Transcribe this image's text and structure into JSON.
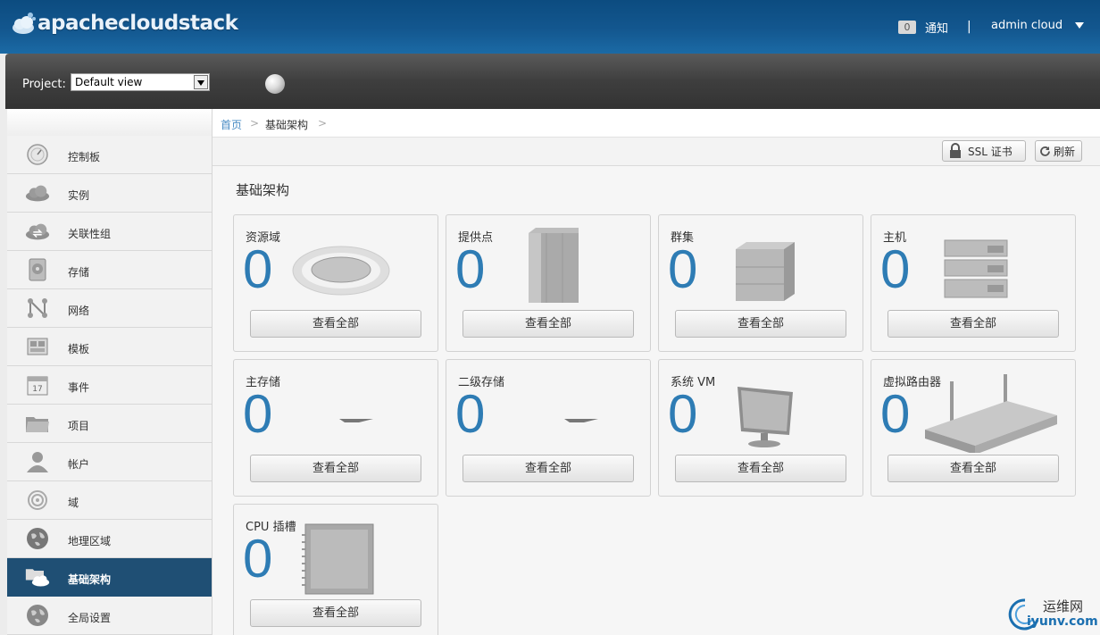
{
  "header": {
    "brand": "apachecloudstack",
    "notification_count": "0",
    "notification_label": "通知",
    "separator": "|",
    "user_label": "admin cloud"
  },
  "projbar": {
    "label": "Project:",
    "selected": "Default view"
  },
  "sidebar": {
    "items": [
      {
        "label": "控制板",
        "icon": "dashboard-icon"
      },
      {
        "label": "实例",
        "icon": "cloud-icon"
      },
      {
        "label": "关联性组",
        "icon": "affinity-icon"
      },
      {
        "label": "存储",
        "icon": "storage-icon"
      },
      {
        "label": "网络",
        "icon": "network-icon"
      },
      {
        "label": "模板",
        "icon": "template-icon"
      },
      {
        "label": "事件",
        "icon": "calendar-icon"
      },
      {
        "label": "项目",
        "icon": "folder-icon"
      },
      {
        "label": "帐户",
        "icon": "user-icon"
      },
      {
        "label": "域",
        "icon": "domain-icon"
      },
      {
        "label": "地理区域",
        "icon": "globe-icon"
      },
      {
        "label": "基础架构",
        "icon": "infrastructure-icon",
        "active": true
      },
      {
        "label": "全局设置",
        "icon": "settings-globe-icon"
      }
    ],
    "calendar_day": "17"
  },
  "breadcrumb": {
    "home": "首页",
    "sep1": ">",
    "current": "基础架构",
    "sep2": ">"
  },
  "toolbar": {
    "ssl_label": "SSL 证书",
    "refresh_label": "刷新"
  },
  "main": {
    "title": "基础架构",
    "cards": [
      {
        "title": "资源域",
        "count": "0",
        "button": "查看全部"
      },
      {
        "title": "提供点",
        "count": "0",
        "button": "查看全部"
      },
      {
        "title": "群集",
        "count": "0",
        "button": "查看全部"
      },
      {
        "title": "主机",
        "count": "0",
        "button": "查看全部"
      },
      {
        "title": "主存储",
        "count": "0",
        "button": "查看全部"
      },
      {
        "title": "二级存储",
        "count": "0",
        "button": "查看全部"
      },
      {
        "title": "系统 VM",
        "count": "0",
        "button": "查看全部"
      },
      {
        "title": "虚拟路由器",
        "count": "0",
        "button": "查看全部"
      },
      {
        "title": "CPU 插槽",
        "count": "0",
        "button": "查看全部"
      }
    ]
  },
  "watermark": {
    "line1": "运维网",
    "line2": "iyunv.com"
  },
  "colors": {
    "header_blue": "#13578f",
    "active_nav": "#1f4f74",
    "count_blue": "#2e7cb4",
    "link_blue": "#4a8cc4"
  }
}
